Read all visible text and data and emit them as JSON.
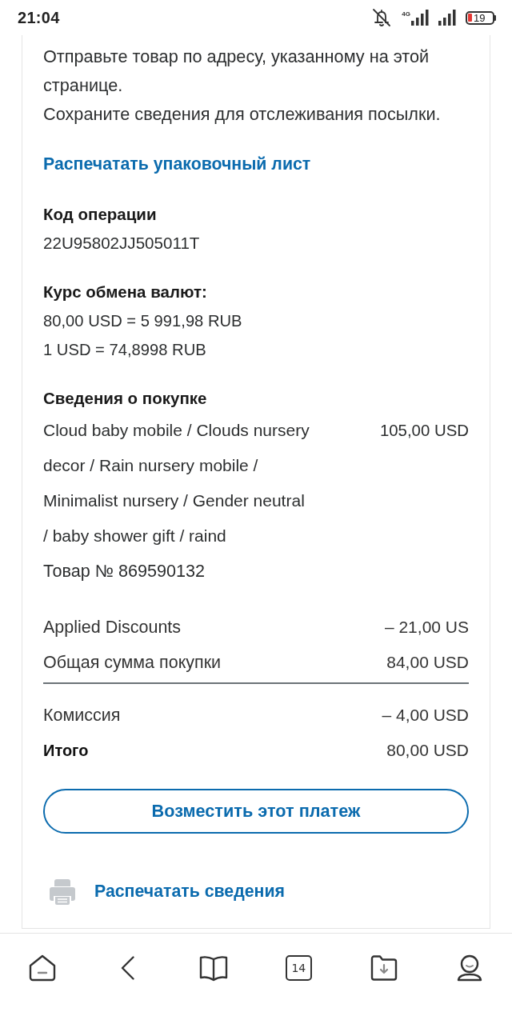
{
  "status_bar": {
    "time": "21:04",
    "network": "4G",
    "battery": "19"
  },
  "instructions": [
    "Отправьте товар по адресу, указанному на этой странице.",
    "Сохраните сведения для отслеживания посылки."
  ],
  "packing_slip_link": "Распечатать упаковочный лист",
  "transaction": {
    "label": "Код операции",
    "value": "22U95802JJ505011T"
  },
  "exchange": {
    "label": "Курс обмена валют:",
    "lines": [
      "80,00 USD = 5 991,98 RUB",
      "1 USD = 74,8998 RUB"
    ]
  },
  "purchase": {
    "label": "Сведения о покупке",
    "item": {
      "title": "Cloud baby mobile / Clouds nursery decor / Rain nursery mobile / Minimalist nursery / Gender neutral / baby shower gift / raind",
      "item_number": "Товар № 869590132",
      "price": "105,00 USD"
    }
  },
  "subtotals": [
    {
      "label": "Applied Discounts",
      "amount": "– 21,00 US",
      "kind": "line"
    },
    {
      "label": "Общая сумма покупки",
      "amount": "84,00 USD",
      "kind": "line"
    }
  ],
  "totals": [
    {
      "label": "Комиссия",
      "amount": "– 4,00 USD",
      "kind": "line"
    },
    {
      "label": "Итого",
      "amount": "80,00 USD",
      "kind": "total"
    }
  ],
  "refund_button": "Возместить этот платеж",
  "print_details": {
    "label": "Распечатать сведения"
  },
  "bottom_nav": [
    {
      "kind": "home"
    },
    {
      "kind": "back"
    },
    {
      "kind": "book"
    },
    {
      "kind": "tabs",
      "label": "14"
    },
    {
      "kind": "downloads"
    },
    {
      "kind": "profile"
    }
  ]
}
